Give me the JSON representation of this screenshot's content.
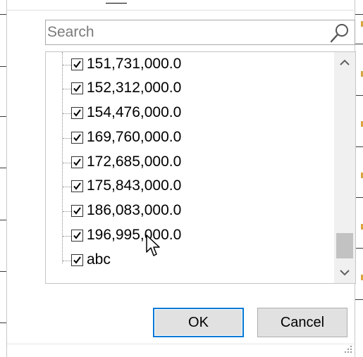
{
  "search": {
    "placeholder": "Search",
    "value": ""
  },
  "filter_list": {
    "items": [
      {
        "label": "151,731,000.0",
        "checked": true
      },
      {
        "label": "152,312,000.0",
        "checked": true
      },
      {
        "label": "154,476,000.0",
        "checked": true
      },
      {
        "label": "169,760,000.0",
        "checked": true
      },
      {
        "label": "172,685,000.0",
        "checked": true
      },
      {
        "label": "175,843,000.0",
        "checked": true
      },
      {
        "label": "186,083,000.0",
        "checked": true
      },
      {
        "label": "196,995,000.0",
        "checked": true
      },
      {
        "label": "abc",
        "checked": true
      }
    ]
  },
  "buttons": {
    "ok_label": "OK",
    "cancel_label": "Cancel"
  },
  "colors": {
    "accent": "#0078d7",
    "button_bg": "#e1e1e1",
    "scroll_thumb": "#c2c2c2"
  },
  "icons": {
    "search": "search-icon",
    "scroll_up": "chevron-up-icon",
    "scroll_down": "chevron-down-icon",
    "checkbox": "checkmark-icon",
    "resize": "resize-grip-icon",
    "cursor": "mouse-pointer-icon"
  }
}
